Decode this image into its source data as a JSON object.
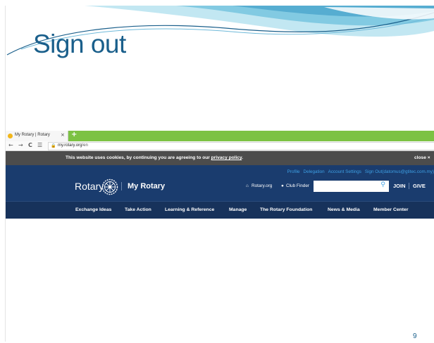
{
  "slide": {
    "title": "Sign out",
    "page_number": "9"
  },
  "browser": {
    "tab_title": "My Rotary | Rotary",
    "tab_close": "×",
    "new_tab": "+",
    "nav": {
      "back": "←",
      "forward": "→",
      "reload": "C",
      "menu": "☰"
    },
    "url_host": "my.rotary.org",
    "url_path": "/en"
  },
  "cookie_banner": {
    "text_before": "This website uses cookies, by continuing you are agreeing to our ",
    "link": "privacy policy",
    "text_after": ".",
    "close": "close ×"
  },
  "header": {
    "util_links": [
      "Profile",
      "Delegation",
      "Account Settings",
      "Sign Out(datomus@gtitec.com.my)"
    ],
    "logo_text": "Rotary",
    "section_title": "My Rotary",
    "rotary_org": "Rotary.org",
    "club_finder": "Club Finder",
    "search_placeholder": "",
    "join": "JOIN",
    "give": "GIVE"
  },
  "main_nav": [
    "Exchange Ideas",
    "Take Action",
    "Learning & Reference",
    "Manage",
    "The Rotary Foundation",
    "News & Media",
    "Member Center"
  ],
  "colors": {
    "title": "#1a5f8b",
    "header_bg": "#1a3c6e",
    "nav_bg": "#17325b",
    "link_blue": "#3ea0e4",
    "cookie_bg": "#4c4c4c",
    "tab_green": "#7cc243"
  },
  "icons": {
    "wheel": "rotary-wheel-icon",
    "search": "search-icon",
    "lock": "lock-icon",
    "home": "home-icon",
    "pin": "map-pin-icon"
  }
}
